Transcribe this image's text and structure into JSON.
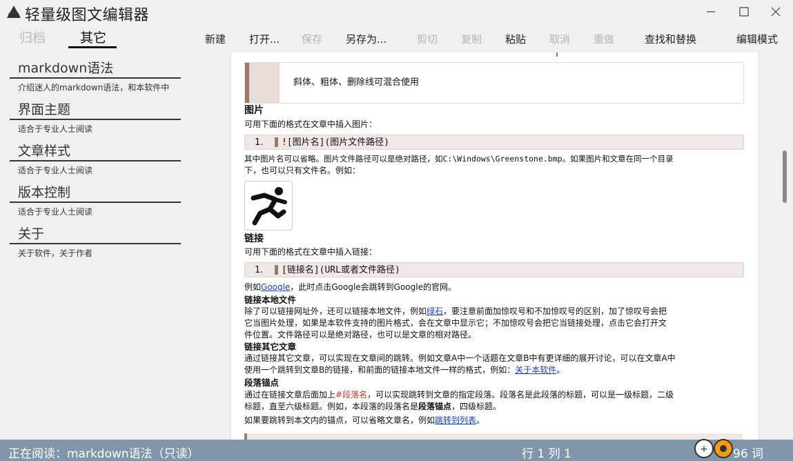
{
  "window": {
    "title": "轻量级图文编辑器"
  },
  "sidebar": {
    "tabs": [
      "归档",
      "其它"
    ],
    "items": [
      {
        "title": "markdown语法",
        "desc": "介绍迷人的markdown语法，和本软件中"
      },
      {
        "title": "界面主题",
        "desc": "适合于专业人士阅读"
      },
      {
        "title": "文章样式",
        "desc": "适合于专业人士阅读"
      },
      {
        "title": "版本控制",
        "desc": "适合于专业人士阅读"
      },
      {
        "title": "关于",
        "desc": "关于软件，关于作者"
      }
    ]
  },
  "toolbar": {
    "new": "新建",
    "open": "打开...",
    "save": "保存",
    "save_as": "另存为...",
    "cut": "剪切",
    "copy": "复制",
    "paste": "粘贴",
    "undo": "取消",
    "redo": "重做",
    "find_replace": "查找和替换",
    "edit_mode": "编辑模式"
  },
  "doc": {
    "quote": "斜体、粗体、删除线可混合使用",
    "img_heading": "图片",
    "img_intro": "可用下面的格式在文章中插入图片：",
    "img_code_num": "1.",
    "img_code": "![图片名](图片文件路径)",
    "img_note_1": "其中图片名可以省略。图片文件路径可以是绝对路径，如C:\\Windows\\Greenstone.bmp。如果图片和文章在同一个目录",
    "img_note_2": "下，也可以只有文件名。例如：",
    "link_heading": "链接",
    "link_intro": "可用下面的格式在文章中插入链接：",
    "link_code_num": "1.",
    "link_code": "[链接名](URL或者文件路径)",
    "google_pre": "例如",
    "google_link": "Google",
    "google_post": "，此时点击Google会跳转到Google的官网。",
    "local_heading": "链接本地文件",
    "local_1_pre": "除了可以链接网址外，还可以链接本地文件，例如",
    "local_1_link": "绿石",
    "local_1_post": "，要注意前面加惊叹号和不加惊叹号的区别，加了惊叹号会把",
    "local_2": "它当图片处理，如果是本软件支持的图片格式，会在文章中显示它；不加惊叹号会把它当链接处理，点击它会打开文",
    "local_3": "件位置。文件路径可以是绝对路径，也可以是文章的相对路径。",
    "other_heading": "链接其它文章",
    "other_1": "通过链接其它文章，可以实现在文章间的跳转。例如文章A中一个话题在文章B中有更详细的展开讨论，可以在文章A中",
    "other_2_pre": "使用一个跳转到文章B的链接，和前面的链接本地文件一样的格式，例如：",
    "other_2_link": "关于本软件",
    "other_2_post": "。",
    "anchor_heading": "段落锚点",
    "anchor_1_pre": "通过在链接文章后面加上",
    "anchor_1_red": "#段落名",
    "anchor_1_post": "，可以实现跳转到文章的指定段落。段落名是此段落的标题，可以是一级标题，二级",
    "anchor_2_pre": "标题，直至六级标题。例如，本段落的段落名是",
    "anchor_2_bold": "段落锚点",
    "anchor_2_post": "，四级标题。",
    "anchor_3_pre": "如果要跳转到本文内的锚点，可以省略文章名，例如",
    "anchor_3_link": "跳转到列表",
    "anchor_3_post": "。"
  },
  "status": {
    "reading": "正在阅读：markdown语法（只读）",
    "position": "行 1 列 1",
    "words": "96 词"
  }
}
